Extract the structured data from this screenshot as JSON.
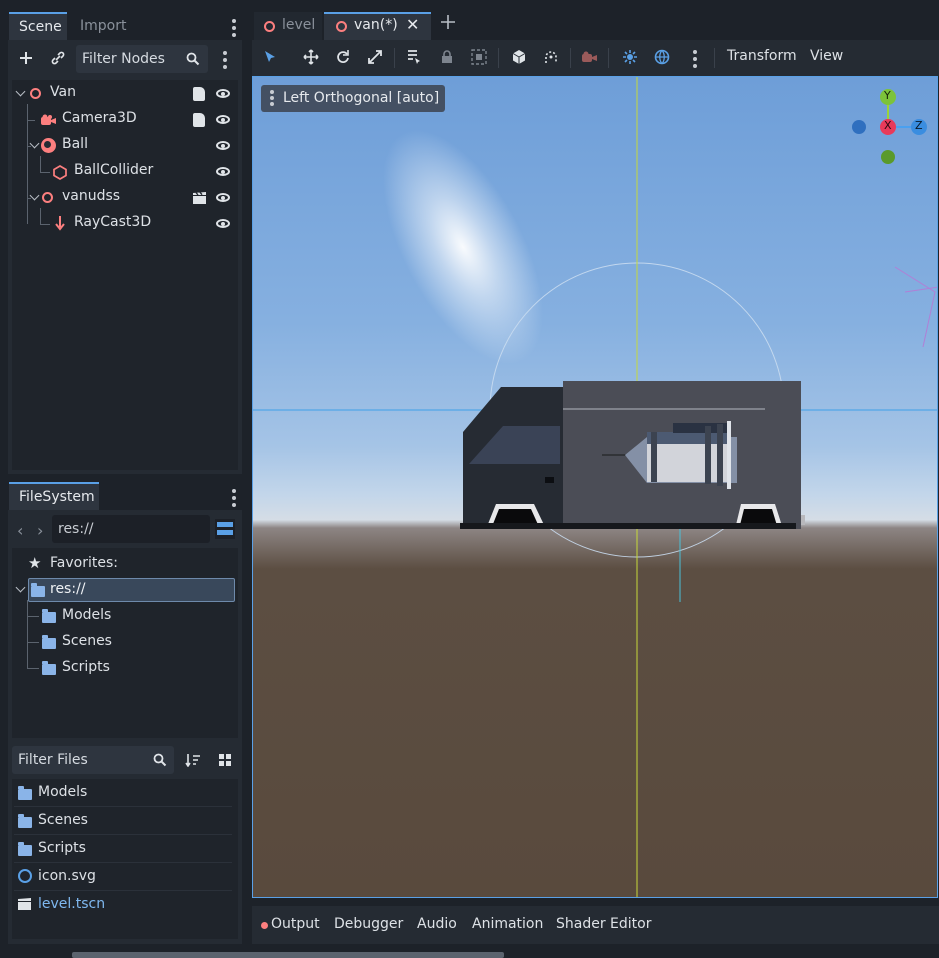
{
  "scene_panel": {
    "tabs": [
      "Scene",
      "Import"
    ],
    "filter_placeholder": "Filter Nodes",
    "nodes": [
      {
        "label": "Van"
      },
      {
        "label": "Camera3D"
      },
      {
        "label": "Ball"
      },
      {
        "label": "BallCollider"
      },
      {
        "label": "vanudss"
      },
      {
        "label": "RayCast3D"
      }
    ]
  },
  "filesystem": {
    "tab": "FileSystem",
    "path": "res://",
    "favorites_label": "Favorites:",
    "tree": [
      {
        "label": "res://"
      },
      {
        "label": "Models"
      },
      {
        "label": "Scenes"
      },
      {
        "label": "Scripts"
      }
    ],
    "filter_placeholder": "Filter Files",
    "files": [
      {
        "label": "Models"
      },
      {
        "label": "Scenes"
      },
      {
        "label": "Scripts"
      },
      {
        "label": "icon.svg"
      },
      {
        "label": "level.tscn"
      }
    ]
  },
  "editor_tabs": [
    {
      "label": "level"
    },
    {
      "label": "van(*)"
    }
  ],
  "toolbar": {
    "transform_label": "Transform",
    "view_label": "View"
  },
  "viewport": {
    "view_label": "Left Orthogonal [auto]",
    "gizmo": {
      "y": "Y",
      "x": "X",
      "z": "Z"
    }
  },
  "bottom_panel": {
    "tabs": [
      "Output",
      "Debugger",
      "Audio",
      "Animation",
      "Shader Editor"
    ]
  },
  "colors": {
    "accent": "#5aa0e6",
    "node_red": "#fc7f7f",
    "folder_blue": "#8ab4e8",
    "sky_top": "#6e9ed8",
    "ground": "#594a3d"
  }
}
